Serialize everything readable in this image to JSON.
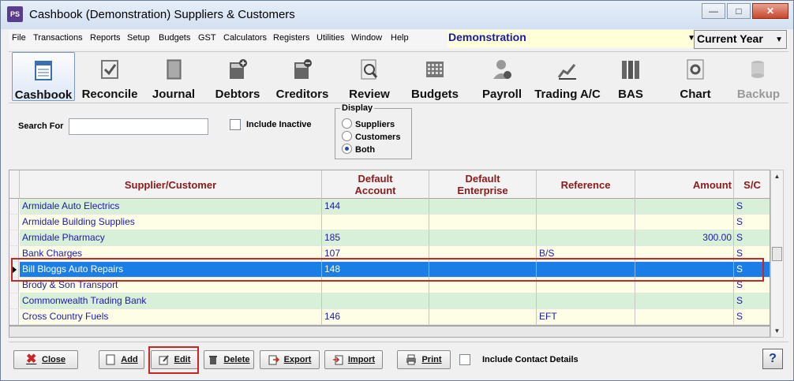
{
  "window": {
    "title": "Cashbook (Demonstration)  Suppliers & Customers",
    "app_icon": "PS"
  },
  "menu": [
    "File",
    "Transactions",
    "Reports",
    "Setup",
    "Budgets",
    "GST",
    "Calculators",
    "Registers",
    "Utilities",
    "Window",
    "Help"
  ],
  "company": {
    "value": "Demonstration"
  },
  "year": {
    "value": "Current Year"
  },
  "toolbar": [
    {
      "label": "Cashbook",
      "icon": "notepad-icon"
    },
    {
      "label": "Reconcile",
      "icon": "checkbox-icon"
    },
    {
      "label": "Journal",
      "icon": "book-icon"
    },
    {
      "label": "Debtors",
      "icon": "calculator-plus-icon"
    },
    {
      "label": "Creditors",
      "icon": "calculator-minus-icon"
    },
    {
      "label": "Review",
      "icon": "magnifier-icon"
    },
    {
      "label": "Budgets",
      "icon": "grid-icon"
    },
    {
      "label": "Payroll",
      "icon": "person-money-icon"
    },
    {
      "label": "Trading A/C",
      "icon": "trend-chart-icon"
    },
    {
      "label": "BAS",
      "icon": "binders-icon"
    },
    {
      "label": "Chart",
      "icon": "gear-doc-icon"
    },
    {
      "label": "Backup",
      "icon": "database-icon"
    }
  ],
  "filter": {
    "search_label": "Search For",
    "search_value": "",
    "inactive_label": "Include Inactive",
    "display_title": "Display",
    "options": [
      "Suppliers",
      "Customers",
      "Both"
    ],
    "selected": "Both"
  },
  "grid": {
    "columns": [
      "Supplier/Customer",
      "Default\nAccount",
      "Default\nEnterprise",
      "Reference",
      "Amount",
      "S/C"
    ],
    "rows": [
      {
        "name": "Armidale Auto Electrics",
        "account": "144",
        "enterprise": "",
        "reference": "",
        "amount": "",
        "sc": "S"
      },
      {
        "name": "Armidale Building Supplies",
        "account": "",
        "enterprise": "",
        "reference": "",
        "amount": "",
        "sc": "S"
      },
      {
        "name": "Armidale Pharmacy",
        "account": "185",
        "enterprise": "",
        "reference": "",
        "amount": "300.00",
        "sc": "S"
      },
      {
        "name": "Bank Charges",
        "account": "107",
        "enterprise": "",
        "reference": "B/S",
        "amount": "",
        "sc": "S"
      },
      {
        "name": "Bill Bloggs Auto Repairs",
        "account": "148",
        "enterprise": "",
        "reference": "",
        "amount": "",
        "sc": "S"
      },
      {
        "name": "Brody & Son Transport",
        "account": "",
        "enterprise": "",
        "reference": "",
        "amount": "",
        "sc": "S"
      },
      {
        "name": "Commonwealth Trading Bank",
        "account": "",
        "enterprise": "",
        "reference": "",
        "amount": "",
        "sc": "S"
      },
      {
        "name": "Cross Country Fuels",
        "account": "146",
        "enterprise": "",
        "reference": "EFT",
        "amount": "",
        "sc": "S"
      }
    ],
    "selected_index": 4
  },
  "buttons": {
    "close": "Close",
    "add": "Add",
    "edit": "Edit",
    "delete": "Delete",
    "export": "Export",
    "import": "Import",
    "print": "Print",
    "contact_label": "Include Contact Details",
    "help": "?"
  }
}
